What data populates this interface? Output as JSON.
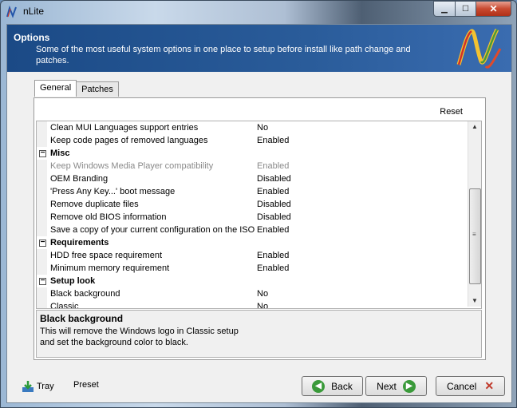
{
  "window": {
    "title": "nLite",
    "min": "▁",
    "max": "☐",
    "close": "✕"
  },
  "banner": {
    "title": "Options",
    "description": "Some of the most useful system options in one place to setup before install like path change and patches."
  },
  "tabs": [
    "General",
    "Patches"
  ],
  "grid": {
    "reset_label": "Reset",
    "rows": [
      {
        "type": "item",
        "name": "Clean MUI Languages support entries",
        "value": "No"
      },
      {
        "type": "item",
        "name": "Keep code pages of removed languages",
        "value": "Enabled"
      },
      {
        "type": "category",
        "name": "Misc",
        "toggle": "−"
      },
      {
        "type": "item",
        "name": "Keep Windows Media Player compatibility",
        "value": "Enabled",
        "disabled": true
      },
      {
        "type": "item",
        "name": "OEM Branding",
        "value": "Disabled"
      },
      {
        "type": "item",
        "name": "'Press Any Key...' boot message",
        "value": "Enabled"
      },
      {
        "type": "item",
        "name": "Remove duplicate files",
        "value": "Disabled"
      },
      {
        "type": "item",
        "name": "Remove old BIOS information",
        "value": "Disabled"
      },
      {
        "type": "item",
        "name": "Save a copy of your current configuration on the ISO",
        "value": "Enabled"
      },
      {
        "type": "category",
        "name": "Requirements",
        "toggle": "−"
      },
      {
        "type": "item",
        "name": "HDD free space requirement",
        "value": "Enabled"
      },
      {
        "type": "item",
        "name": "Minimum memory requirement",
        "value": "Enabled"
      },
      {
        "type": "category",
        "name": "Setup look",
        "toggle": "−"
      },
      {
        "type": "item",
        "name": "Black background",
        "value": "No"
      },
      {
        "type": "item",
        "name": "Classic",
        "value": "No"
      }
    ],
    "scroll_up": "▲",
    "scroll_down": "▼",
    "scroll_grip": "≡"
  },
  "help": {
    "title": "Black background",
    "description": "This will remove the Windows logo in Classic setup and set the background color to black."
  },
  "footer": {
    "tray_label": "Tray",
    "preset_label": "Preset",
    "back_label": "Back",
    "next_label": "Next",
    "cancel_label": "Cancel",
    "back_icon": "◀",
    "next_icon": "▶",
    "cancel_icon": "✕"
  },
  "colors": {
    "banner": "#1b4a86",
    "accent_green": "#3a9a3a",
    "cancel_red": "#c0392b"
  }
}
